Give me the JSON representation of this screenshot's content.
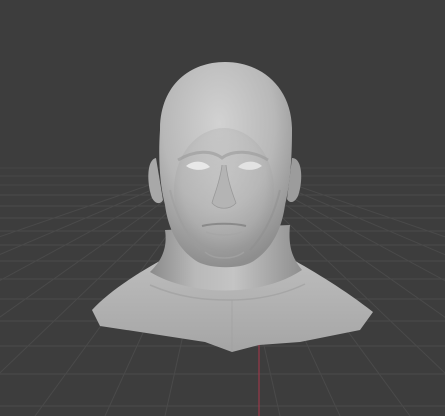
{
  "viewport": {
    "name": "3D Viewport",
    "background_color": "#3d3d3d",
    "grid_color": "#4a4a4a",
    "grid_color_dim": "#444444",
    "axis_y_color": "#9a3a4a",
    "shading": "solid",
    "object": "head-bust-sculpt"
  }
}
